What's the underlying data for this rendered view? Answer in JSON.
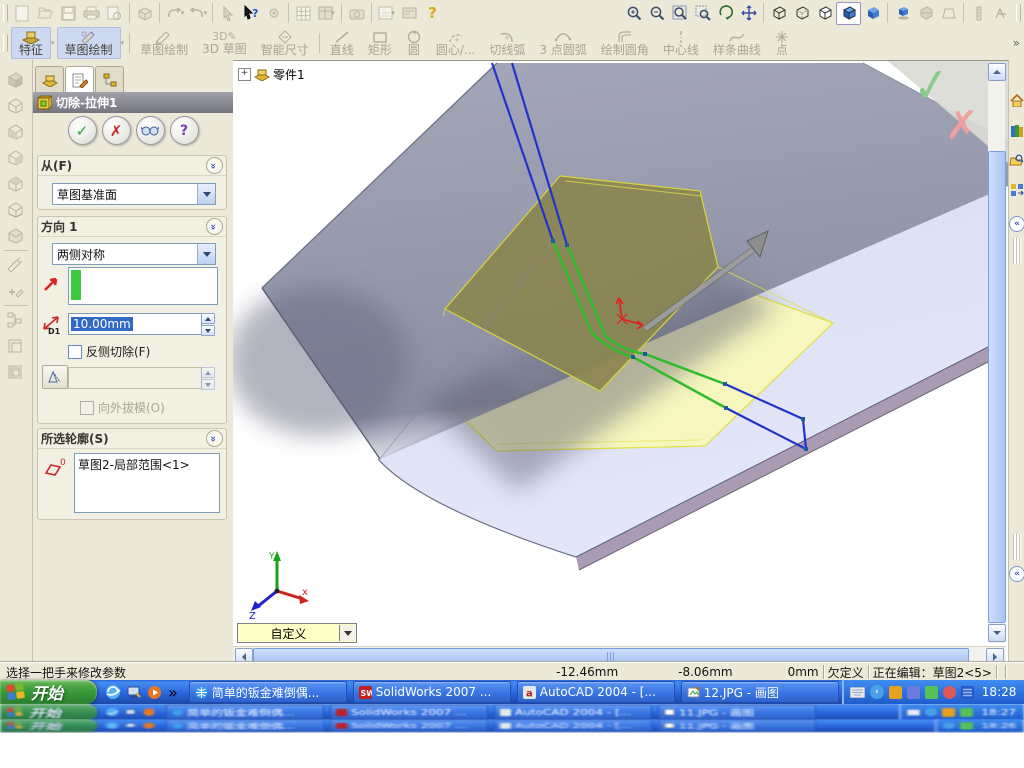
{
  "toolbars": {
    "standard": {
      "help": "?"
    },
    "tools": {
      "feature": "特征",
      "sketch_flyout": "草图绘制",
      "sketch": "草图绘制",
      "sketch3d": "3D 草图",
      "smart_dim": "智能尺寸",
      "line": "直线",
      "rect": "矩形",
      "circle": "圆",
      "center_arc": "圆心/...",
      "tangent_arc": "切线弧",
      "arc3": "3 点圆弧",
      "fillet": "绘制圆角",
      "centerline": "中心线",
      "spline": "样条曲线",
      "point": "点",
      "overflow": "»"
    }
  },
  "panel": {
    "title": "切除-拉伸1",
    "ok": "✓",
    "cancel": "✗",
    "help": "?",
    "from_header": "从(F)",
    "from_value": "草图基准面",
    "dir_header": "方向 1",
    "dir_value": "两侧对称",
    "depth_label": "D1",
    "depth_value": "10.00mm",
    "flip_label": "反侧切除(F)",
    "draft_label": "向外拔模(O)",
    "contours_header": "所选轮廓(S)",
    "contour_item": "草图2-局部范围<1>"
  },
  "viewport": {
    "tree_expand": "+",
    "tree_root": "零件1",
    "view_combo": "自定义",
    "axis_x": "x",
    "axis_y": "Y",
    "axis_z": "Z",
    "confirm_ok": "✓",
    "confirm_cancel": "✗"
  },
  "statusbar": {
    "hint": "选择一把手来修改参数",
    "coord_x": "-12.46mm",
    "coord_y": "-8.06mm",
    "coord_z": "0mm",
    "state": "欠定义",
    "editing": "正在编辑：草图2<5>"
  },
  "taskbar": {
    "rows": [
      {
        "start": "开始",
        "task1": "简单的钣金难倒偶...",
        "task2": "SolidWorks 2007 ...",
        "task3": "AutoCAD 2004 - [...",
        "task4": "12.JPG - 画图",
        "time": "18:28"
      },
      {
        "start": "开始",
        "task1": "简单的钣金难倒偶...",
        "task2": "SolidWorks 2007 ...",
        "task3": "AutoCAD 2004 - [...",
        "task4": "11.JPG - 画图",
        "time": "18:27"
      },
      {
        "start": "开始",
        "task1": "简单的钣金难倒偶...",
        "task2": "SolidWorks 2007 ...",
        "task3": "AutoCAD 2004 - [...",
        "task4": "11.JPG - 画图",
        "time": "18:26"
      }
    ]
  },
  "colors": {
    "taskbar_blue": "#2a66dd",
    "start_green": "#3a9b3a",
    "selection_blue": "#316ac5",
    "combo_yellow": "#ffffc8",
    "sketch_green": "#2abf2a",
    "sketch_blue": "#2233cc",
    "preview_yellow": "#f7f7bb",
    "flange_gray": "#9397a9",
    "plate_lavender": "#dfe3f6"
  }
}
